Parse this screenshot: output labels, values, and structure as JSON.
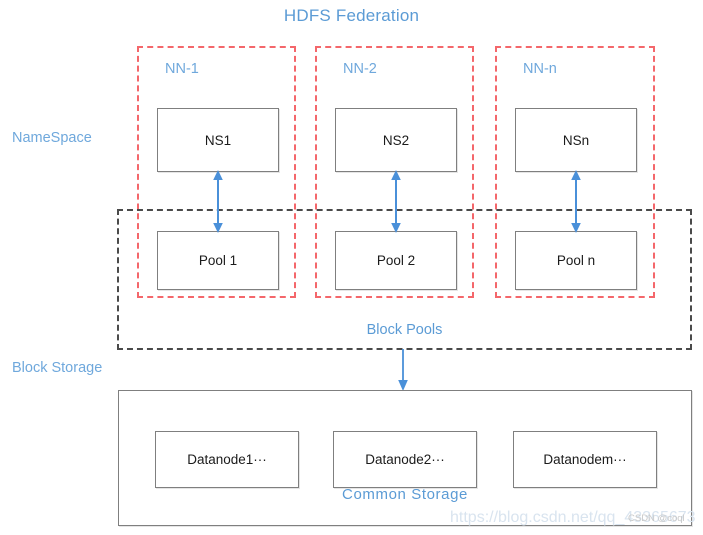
{
  "diagram": {
    "title": "HDFS Federation",
    "side_labels": [
      {
        "name": "namespace",
        "text": "NameSpace"
      },
      {
        "name": "blockstorage",
        "text": "Block Storage"
      }
    ],
    "namenode_columns": [
      {
        "label": "NN-1",
        "namespace": "NS1",
        "pool": "Pool 1"
      },
      {
        "label": "NN-2",
        "namespace": "NS2",
        "pool": "Pool 2"
      },
      {
        "label": "NN-n",
        "namespace": "NSn",
        "pool": "Pool n"
      }
    ],
    "block_pools": {
      "label": "Block Pools"
    },
    "common_storage": {
      "label": "Common  Storage",
      "datanodes": [
        "Datanode1···",
        "Datanode2···",
        "Datanodem···"
      ]
    },
    "arrows": {
      "ns_pool_arrow_name": "bidirectional-arrow",
      "pools_storage_arrow_name": "down-arrow"
    },
    "watermark": {
      "url": "https://blog.csdn.net/qq_43365673",
      "badge": "CSDN @coql"
    },
    "colors": {
      "title_blue": "#5b9bd5",
      "label_blue": "#6fa8dc",
      "dashed_red": "#f4676b",
      "dashed_dark": "#4a4a4a",
      "box_border_gray": "#7f7f7f",
      "arrow_blue": "#4a90d9",
      "background": "#ffffff"
    }
  }
}
